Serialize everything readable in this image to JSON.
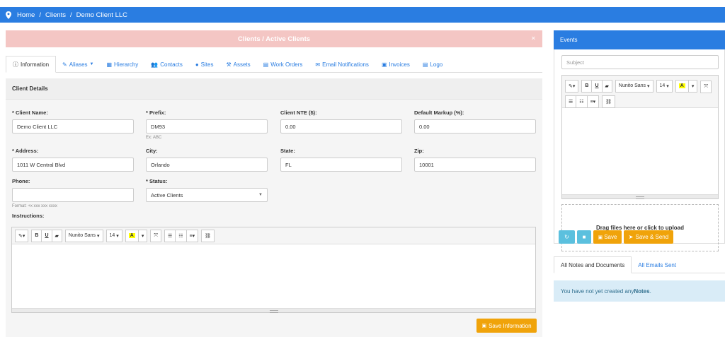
{
  "breadcrumb": {
    "items": [
      "Home",
      "Clients",
      "Demo Client LLC"
    ]
  },
  "alert": {
    "text": "Clients / Active Clients",
    "close": "×"
  },
  "tabs": [
    {
      "label": "Information",
      "icon": "ⓘ"
    },
    {
      "label": "Aliases",
      "icon": "✎"
    },
    {
      "label": "Hierarchy",
      "icon": "▦"
    },
    {
      "label": "Contacts",
      "icon": "👥"
    },
    {
      "label": "Sites",
      "icon": "●"
    },
    {
      "label": "Assets",
      "icon": "⚒"
    },
    {
      "label": "Work Orders",
      "icon": "▤"
    },
    {
      "label": "Email Notifications",
      "icon": "✉"
    },
    {
      "label": "Invoices",
      "icon": "▣"
    },
    {
      "label": "Logo",
      "icon": "▤"
    }
  ],
  "client": {
    "section_title": "Client Details",
    "name_label": "* Client Name:",
    "name_value": "Demo Client LLC",
    "prefix_label": "* Prefix:",
    "prefix_value": "DM93",
    "prefix_hint": "Ex: ABC",
    "nte_label": "Client NTE ($):",
    "nte_value": "0.00",
    "markup_label": "Default Markup (%):",
    "markup_value": "0.00",
    "address_label": "* Address:",
    "address_value": "1011 W Central Blvd",
    "city_label": "City:",
    "city_value": "Orlando",
    "state_label": "State:",
    "state_value": "FL",
    "zip_label": "Zip:",
    "zip_value": "10001",
    "phone_label": "Phone:",
    "phone_value": "",
    "phone_hint": "Format: +x xxx xxx xxxx",
    "status_label": "* Status:",
    "status_value": "Active Clients",
    "instructions_label": "Instructions:",
    "save_label": "Save Information"
  },
  "editor": {
    "font": "Nunito Sans",
    "size": "14"
  },
  "events": {
    "title": "Events",
    "subject_placeholder": "Subject",
    "drop_text": "Drag files here or click to upload",
    "save": "Save",
    "save_send": "Save & Send",
    "tabs": [
      "All Notes and Documents",
      "All Emails Sent"
    ],
    "notice_prefix": "You have not yet created any ",
    "notice_bold": "Notes",
    "notice_suffix": "."
  },
  "colors": {
    "primary": "#2a7de1",
    "warning": "#f0a30a",
    "info": "#5bc0de",
    "alert_bg": "#f4c6c4"
  }
}
